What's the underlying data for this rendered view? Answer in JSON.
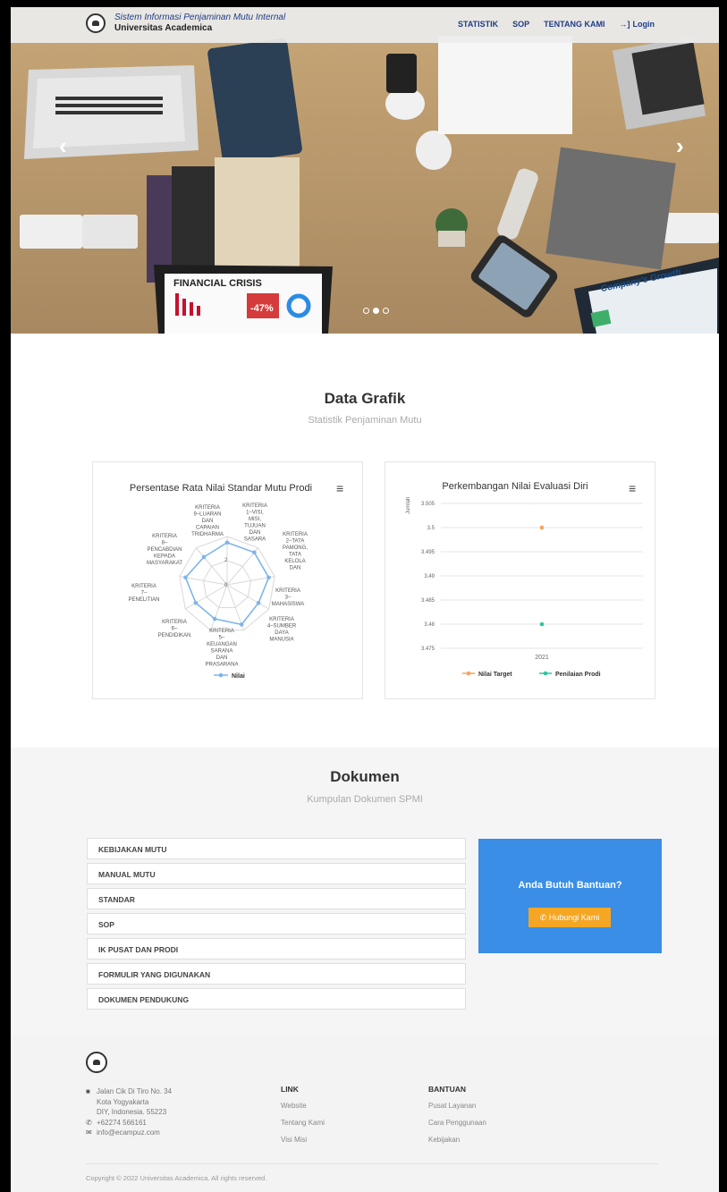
{
  "header": {
    "title": "Sistem Informasi Penjaminan Mutu Internal",
    "subtitle": "Universitas Academica",
    "nav": [
      {
        "label": "STATISTIK"
      },
      {
        "label": "SOP"
      },
      {
        "label": "TENTANG KAMI"
      },
      {
        "label": "Login",
        "icon": "login-icon"
      }
    ]
  },
  "hero": {
    "sign_text": "FINANCIAL CRISIS",
    "sign_percent": "-47%",
    "tablet_text": "Company's Growth",
    "slides": 3,
    "active_slide": 2
  },
  "grafik": {
    "title": "Data Grafik",
    "subtitle": "Statistik Penjaminan Mutu"
  },
  "chart_data": [
    {
      "type": "radar",
      "title": "Persentase Rata Nilai Standar Mutu Prodi",
      "categories": [
        "KRITERIA 1–VISI, MISI, TUJUAN DAN SASARA",
        "KRITERIA 2–TATA PAMONG, TATA KELOLA DAN",
        "KRITERIA 3–MAHASISWA",
        "KRITERIA 4–SUMBER DAYA MANUSIA",
        "KRITERIA 5–KEUANGAN SARANA DAN PRASARANA",
        "KRITERIA 6–PENDIDIKAN",
        "KRITERIA 7–PENELITIAN",
        "KRITERIA 8–PENCABDIAN KEPADA MASYARAKAT",
        "KRITERIA 9–LUARAN DAN CAPAIAN TRIDHARMA"
      ],
      "series": [
        {
          "name": "Nilai",
          "values": [
            3.5,
            3.5,
            3.5,
            3.0,
            3.5,
            3.0,
            3.0,
            3.5,
            3.0
          ]
        }
      ],
      "radial_ticks": [
        "0",
        "2"
      ],
      "rmax": 4,
      "legend": "bottom",
      "color": "#7cb5ec"
    },
    {
      "type": "line",
      "title": "Perkembangan Nilai Evaluasi Diri",
      "categories": [
        "2021"
      ],
      "ylabel": "Jumlah",
      "ylim": [
        3.475,
        3.505
      ],
      "yticks": [
        "3.505",
        "3.5",
        "3.495",
        "3.49",
        "3.485",
        "3.48",
        "3.475"
      ],
      "series": [
        {
          "name": "Nilai Target",
          "values": [
            3.5
          ],
          "color": "#f7a35c"
        },
        {
          "name": "Penilaian Prodi",
          "values": [
            3.48
          ],
          "color": "#2ec4a0"
        }
      ],
      "legend": "bottom",
      "grid": true
    }
  ],
  "dokumen": {
    "title": "Dokumen",
    "subtitle": "Kumpulan Dokumen SPMI",
    "items": [
      "KEBIJAKAN MUTU",
      "MANUAL MUTU",
      "STANDAR",
      "SOP",
      "IK PUSAT DAN PRODI",
      "FORMULIR YANG DIGUNAKAN",
      "DOKUMEN PENDUKUNG"
    ],
    "help_title": "Anda Butuh Bantuan?",
    "help_button": "Hubungi Kami"
  },
  "footer": {
    "address_lines": [
      "Jalan Cik Di Tiro No. 34",
      "Kota Yogyakarta",
      "DIY, Indonesia. 55223"
    ],
    "phone": "+62274 566161",
    "email": "info@ecampuz.com",
    "link_title": "LINK",
    "links": [
      "Website",
      "Tentang Kami",
      "Visi Misi"
    ],
    "bantuan_title": "BANTUAN",
    "bantuan": [
      "Pusat Layanan",
      "Cara Penggunaan",
      "Kebijakan"
    ],
    "copyright": "Copyright © 2022 Universitas Academica. All rights reserved."
  }
}
